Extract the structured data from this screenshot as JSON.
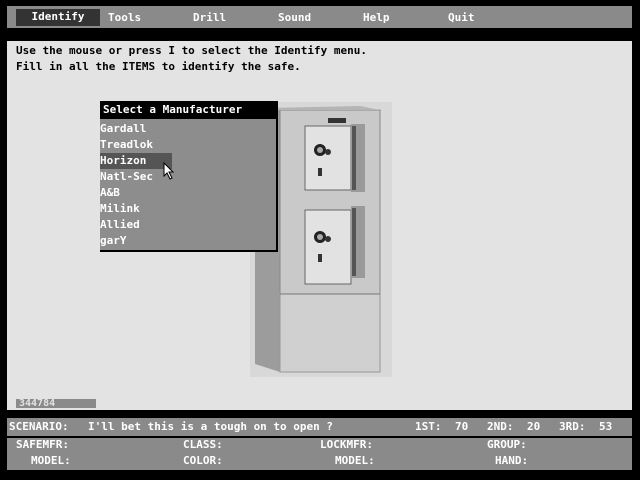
{
  "menu": {
    "items": [
      {
        "label": "Identify"
      },
      {
        "label": "Tools"
      },
      {
        "label": "Drill"
      },
      {
        "label": "Sound"
      },
      {
        "label": "Help"
      },
      {
        "label": "Quit"
      }
    ],
    "active": "Identify"
  },
  "instructions": {
    "line1": "Use the mouse or press I to select the Identify menu.",
    "line2": "Fill in all the ITEMS to identify the safe."
  },
  "dropdown": {
    "title": "Select a Manufacturer",
    "items": [
      "Gardall",
      "Treadlok",
      "Horizon",
      "Natl-Sec",
      "A&B",
      "Milink",
      "Allied",
      "garY"
    ],
    "selected": "Horizon"
  },
  "status_id": "344784",
  "scenario": {
    "label": "SCENARIO:",
    "text": "I'll bet this is a tough on to open ?",
    "first_label": "1ST:",
    "first_value": "70",
    "second_label": "2ND:",
    "second_value": "20",
    "third_label": "3RD:",
    "third_value": "53"
  },
  "fields": {
    "safemfr": "SAFEMFR:",
    "class": "CLASS:",
    "lockmfr": "LOCKMFR:",
    "group": "GROUP:",
    "model1": "MODEL:",
    "color": "COLOR:",
    "model2": "MODEL:",
    "hand": "HAND:"
  },
  "colors": {
    "panel": "#e3e3e3",
    "bar": "#8a8a8a",
    "highlight": "#333333"
  }
}
